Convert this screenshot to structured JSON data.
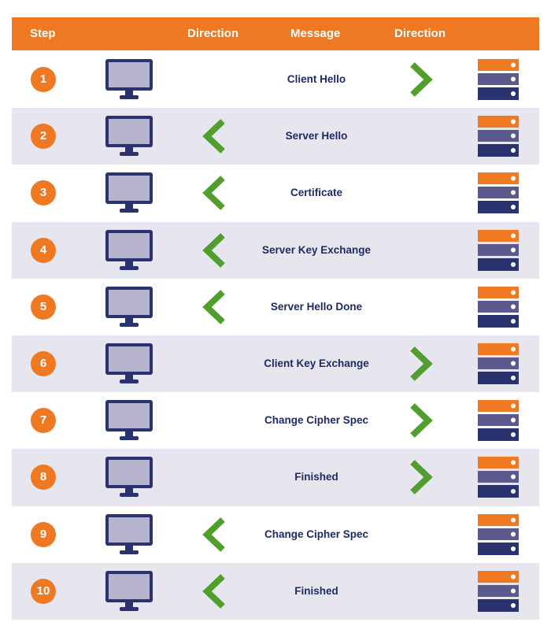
{
  "header": {
    "step": "Step",
    "direction_left": "Direction",
    "message": "Message",
    "direction_right": "Direction"
  },
  "colors": {
    "orange": "#EF7823",
    "navy": "#2B3270",
    "screen": "#B5B4CC",
    "server_mid": "#5A5A8C",
    "green": "#519E2D",
    "row_alt": "#E7E6EF"
  },
  "steps": [
    {
      "number": "1",
      "message": "Client Hello",
      "direction": "client-to-server"
    },
    {
      "number": "2",
      "message": "Server Hello",
      "direction": "server-to-client"
    },
    {
      "number": "3",
      "message": "Certificate",
      "direction": "server-to-client"
    },
    {
      "number": "4",
      "message": "Server Key Exchange",
      "direction": "server-to-client"
    },
    {
      "number": "5",
      "message": "Server Hello Done",
      "direction": "server-to-client"
    },
    {
      "number": "6",
      "message": "Client Key Exchange",
      "direction": "client-to-server"
    },
    {
      "number": "7",
      "message": "Change Cipher Spec",
      "direction": "client-to-server"
    },
    {
      "number": "8",
      "message": "Finished",
      "direction": "client-to-server"
    },
    {
      "number": "9",
      "message": "Change Cipher Spec",
      "direction": "server-to-client"
    },
    {
      "number": "10",
      "message": "Finished",
      "direction": "server-to-client"
    }
  ]
}
